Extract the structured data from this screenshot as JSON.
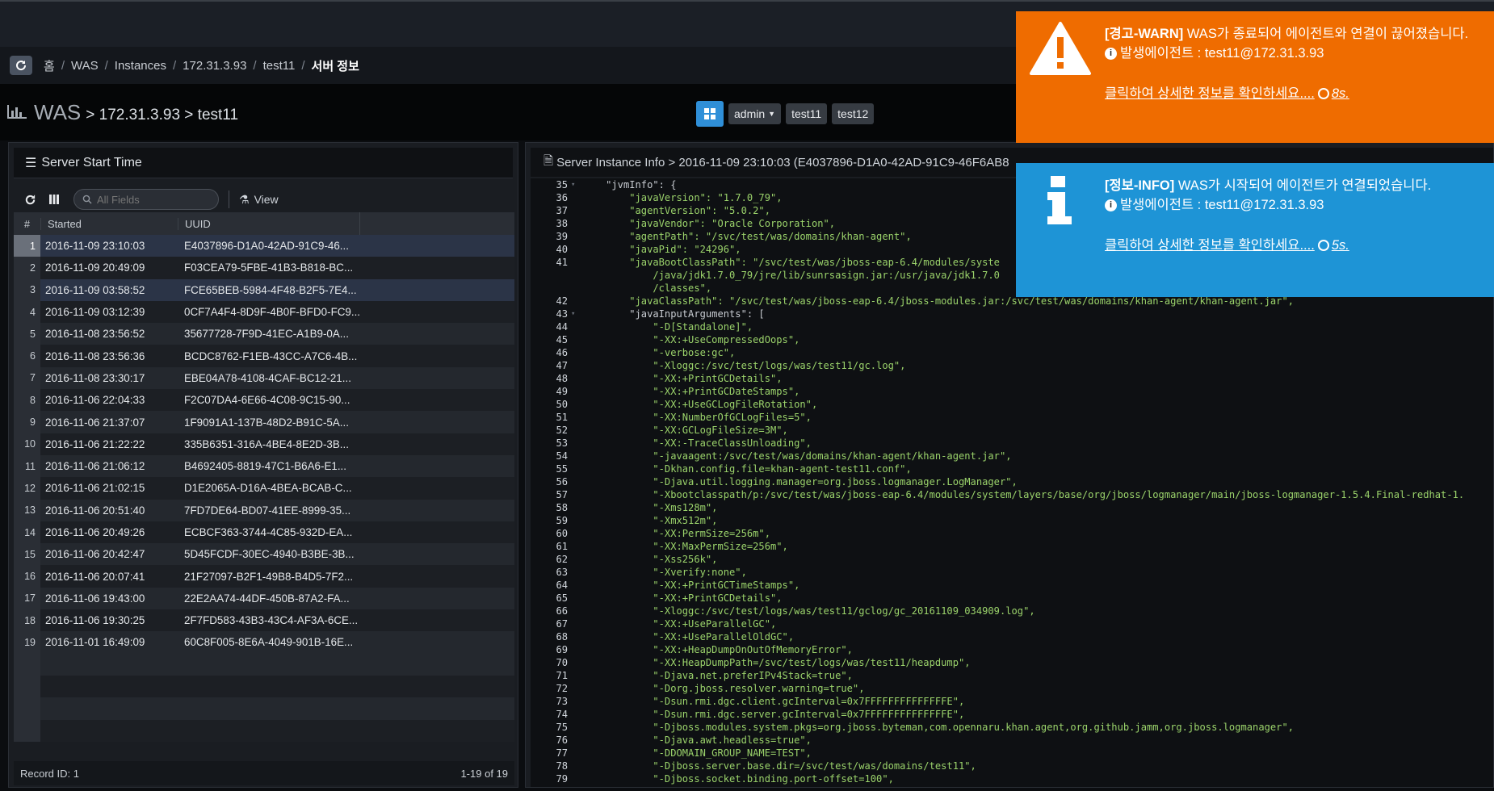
{
  "breadcrumb": [
    "홈",
    "WAS",
    "Instances",
    "172.31.3.93",
    "test11",
    "서버 정보"
  ],
  "title": {
    "main": "WAS",
    "path": "> 172.31.3.93 > test11"
  },
  "switcher": {
    "user": "admin",
    "items": [
      "test11",
      "test12"
    ]
  },
  "left_panel": {
    "title": "Server Start Time",
    "search_placeholder": "All Fields",
    "view_label": "View",
    "columns": {
      "num": "#",
      "started": "Started",
      "uuid": "UUID"
    },
    "rows": [
      {
        "n": "1",
        "started": "2016-11-09 23:10:03",
        "uuid": "E4037896-D1A0-42AD-91C9-46..."
      },
      {
        "n": "2",
        "started": "2016-11-09 20:49:09",
        "uuid": "F03CEA79-5FBE-41B3-B818-BC..."
      },
      {
        "n": "3",
        "started": "2016-11-09 03:58:52",
        "uuid": "FCE65BEB-5984-4F48-B2F5-7E4..."
      },
      {
        "n": "4",
        "started": "2016-11-09 03:12:39",
        "uuid": "0CF7A4F4-8D9F-4B0F-BFD0-FC9..."
      },
      {
        "n": "5",
        "started": "2016-11-08 23:56:52",
        "uuid": "35677728-7F9D-41EC-A1B9-0A..."
      },
      {
        "n": "6",
        "started": "2016-11-08 23:56:36",
        "uuid": "BCDC8762-F1EB-43CC-A7C6-4B..."
      },
      {
        "n": "7",
        "started": "2016-11-08 23:30:17",
        "uuid": "EBE04A78-4108-4CAF-BC12-21..."
      },
      {
        "n": "8",
        "started": "2016-11-06 22:04:33",
        "uuid": "F2C07DA4-6E66-4C08-9C15-90..."
      },
      {
        "n": "9",
        "started": "2016-11-06 21:37:07",
        "uuid": "1F9091A1-137B-48D2-B91C-5A..."
      },
      {
        "n": "10",
        "started": "2016-11-06 21:22:22",
        "uuid": "335B6351-316A-4BE4-8E2D-3B..."
      },
      {
        "n": "11",
        "started": "2016-11-06 21:06:12",
        "uuid": "B4692405-8819-47C1-B6A6-E1..."
      },
      {
        "n": "12",
        "started": "2016-11-06 21:02:15",
        "uuid": "D1E2065A-D16A-4BEA-BCAB-C..."
      },
      {
        "n": "13",
        "started": "2016-11-06 20:51:40",
        "uuid": "7FD7DE64-BD07-41EE-8999-35..."
      },
      {
        "n": "14",
        "started": "2016-11-06 20:49:26",
        "uuid": "ECBCF363-3744-4C85-932D-EA..."
      },
      {
        "n": "15",
        "started": "2016-11-06 20:42:47",
        "uuid": "5D45FCDF-30EC-4940-B3BE-3B..."
      },
      {
        "n": "16",
        "started": "2016-11-06 20:07:41",
        "uuid": "21F27097-B2F1-49B8-B4D5-7F2..."
      },
      {
        "n": "17",
        "started": "2016-11-06 19:43:00",
        "uuid": "22E2AA74-44DF-450B-87A2-FA..."
      },
      {
        "n": "18",
        "started": "2016-11-06 19:30:25",
        "uuid": "2F7FD583-43B3-43C4-AF3A-6CE..."
      },
      {
        "n": "19",
        "started": "2016-11-01 16:49:09",
        "uuid": "60C8F005-8E6A-4049-901B-16E..."
      }
    ],
    "record_id": "Record ID: 1",
    "pager": "1-19 of 19"
  },
  "right_panel": {
    "title": "Server Instance Info > 2016-11-09 23:10:03 (E4037896-D1A0-42AD-91C9-46F6AB8",
    "lines": [
      {
        "n": "35",
        "fold": true,
        "text": "    \"jvmInfo\": {",
        "plain": true
      },
      {
        "n": "36",
        "text": "        \"javaVersion\": \"1.7.0_79\","
      },
      {
        "n": "37",
        "text": "        \"agentVersion\": \"5.0.2\","
      },
      {
        "n": "38",
        "text": "        \"javaVendor\": \"Oracle Corporation\","
      },
      {
        "n": "39",
        "text": "        \"agentPath\": \"/svc/test/was/domains/khan-agent\","
      },
      {
        "n": "40",
        "text": "        \"javaPid\": \"24296\","
      },
      {
        "n": "41",
        "text": "        \"javaBootClassPath\": \"/svc/test/was/jboss-eap-6.4/modules/syste\n            /java/jdk1.7.0_79/jre/lib/sunrsasign.jar:/usr/java/jdk1.7.0\n            /classes\",",
        "tall": true
      },
      {
        "n": "42",
        "text": "        \"javaClassPath\": \"/svc/test/was/jboss-eap-6.4/jboss-modules.jar:/svc/test/was/domains/khan-agent/khan-agent.jar\","
      },
      {
        "n": "43",
        "fold": true,
        "text": "        \"javaInputArguments\": [",
        "plain": true
      },
      {
        "n": "44",
        "text": "            \"-D[Standalone]\","
      },
      {
        "n": "45",
        "text": "            \"-XX:+UseCompressedOops\","
      },
      {
        "n": "46",
        "text": "            \"-verbose:gc\","
      },
      {
        "n": "47",
        "text": "            \"-Xloggc:/svc/test/logs/was/test11/gc.log\","
      },
      {
        "n": "48",
        "text": "            \"-XX:+PrintGCDetails\","
      },
      {
        "n": "49",
        "text": "            \"-XX:+PrintGCDateStamps\","
      },
      {
        "n": "50",
        "text": "            \"-XX:+UseGCLogFileRotation\","
      },
      {
        "n": "51",
        "text": "            \"-XX:NumberOfGCLogFiles=5\","
      },
      {
        "n": "52",
        "text": "            \"-XX:GCLogFileSize=3M\","
      },
      {
        "n": "53",
        "text": "            \"-XX:-TraceClassUnloading\","
      },
      {
        "n": "54",
        "text": "            \"-javaagent:/svc/test/was/domains/khan-agent/khan-agent.jar\","
      },
      {
        "n": "55",
        "text": "            \"-Dkhan.config.file=khan-agent-test11.conf\","
      },
      {
        "n": "56",
        "text": "            \"-Djava.util.logging.manager=org.jboss.logmanager.LogManager\","
      },
      {
        "n": "57",
        "text": "            \"-Xbootclasspath/p:/svc/test/was/jboss-eap-6.4/modules/system/layers/base/org/jboss/logmanager/main/jboss-logmanager-1.5.4.Final-redhat-1."
      },
      {
        "n": "58",
        "text": "            \"-Xms128m\","
      },
      {
        "n": "59",
        "text": "            \"-Xmx512m\","
      },
      {
        "n": "60",
        "text": "            \"-XX:PermSize=256m\","
      },
      {
        "n": "61",
        "text": "            \"-XX:MaxPermSize=256m\","
      },
      {
        "n": "62",
        "text": "            \"-Xss256k\","
      },
      {
        "n": "63",
        "text": "            \"-Xverify:none\","
      },
      {
        "n": "64",
        "text": "            \"-XX:+PrintGCTimeStamps\","
      },
      {
        "n": "65",
        "text": "            \"-XX:+PrintGCDetails\","
      },
      {
        "n": "66",
        "text": "            \"-Xloggc:/svc/test/logs/was/test11/gclog/gc_20161109_034909.log\","
      },
      {
        "n": "67",
        "text": "            \"-XX:+UseParallelGC\","
      },
      {
        "n": "68",
        "text": "            \"-XX:+UseParallelOldGC\","
      },
      {
        "n": "69",
        "text": "            \"-XX:+HeapDumpOnOutOfMemoryError\","
      },
      {
        "n": "70",
        "text": "            \"-XX:HeapDumpPath=/svc/test/logs/was/test11/heapdump\","
      },
      {
        "n": "71",
        "text": "            \"-Djava.net.preferIPv4Stack=true\","
      },
      {
        "n": "72",
        "text": "            \"-Dorg.jboss.resolver.warning=true\","
      },
      {
        "n": "73",
        "text": "            \"-Dsun.rmi.dgc.client.gcInterval=0x7FFFFFFFFFFFFFFE\","
      },
      {
        "n": "74",
        "text": "            \"-Dsun.rmi.dgc.server.gcInterval=0x7FFFFFFFFFFFFFFE\","
      },
      {
        "n": "75",
        "text": "            \"-Djboss.modules.system.pkgs=org.jboss.byteman,com.opennaru.khan.agent,org.github.jamm,org.jboss.logmanager\","
      },
      {
        "n": "76",
        "text": "            \"-Djava.awt.headless=true\","
      },
      {
        "n": "77",
        "text": "            \"-DDOMAIN_GROUP_NAME=TEST\","
      },
      {
        "n": "78",
        "text": "            \"-Djboss.server.base.dir=/svc/test/was/domains/test11\","
      },
      {
        "n": "79",
        "text": "            \"-Djboss.socket.binding.port-offset=100\","
      }
    ]
  },
  "toasts": [
    {
      "level": "warn",
      "tag": "[경고-WARN]",
      "message": " WAS가 종료되어 에이전트와 연결이 끊어졌습니다.",
      "agent": "발생에이전트 : test11@172.31.3.93",
      "link": "클릭하여 상세한 정보를 확인하세요.",
      "ellipsis": "...",
      "timer": "8s."
    },
    {
      "level": "info",
      "tag": "[정보-INFO]",
      "message": " WAS가 시작되어 에이전트가 연결되었습니다.",
      "agent": "발생에이전트 : test11@172.31.3.93",
      "link": "클릭하여 상세한 정보를 확인하세요.",
      "ellipsis": "...",
      "timer": "5s."
    }
  ],
  "colors": {
    "warn": "#ef6c00",
    "info": "#1e94d6",
    "accent": "#2f8fd8",
    "code_string": "#9bd36b"
  }
}
